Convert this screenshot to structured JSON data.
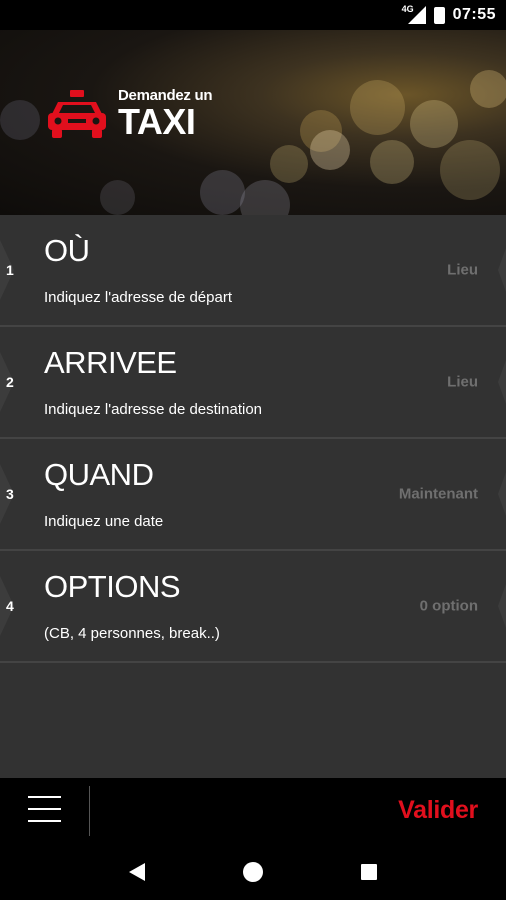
{
  "status_bar": {
    "network": "4G",
    "time": "07:55"
  },
  "header": {
    "brand_subtitle": "Demandez un",
    "brand_title": "TAXI"
  },
  "steps": [
    {
      "number": "1",
      "title": "OÙ",
      "description": "Indiquez l'adresse de départ",
      "value": "Lieu"
    },
    {
      "number": "2",
      "title": "ARRIVEE",
      "description": "Indiquez l'adresse de destination",
      "value": "Lieu"
    },
    {
      "number": "3",
      "title": "QUAND",
      "description": "Indiquez une date",
      "value": "Maintenant"
    },
    {
      "number": "4",
      "title": "OPTIONS",
      "description": "(CB, 4 personnes, break..)",
      "value": "0 option"
    }
  ],
  "bottom_bar": {
    "validate_label": "Valider"
  },
  "colors": {
    "accent": "#e10f1d",
    "list_bg": "#323232",
    "value_text": "#6f6f6f"
  }
}
